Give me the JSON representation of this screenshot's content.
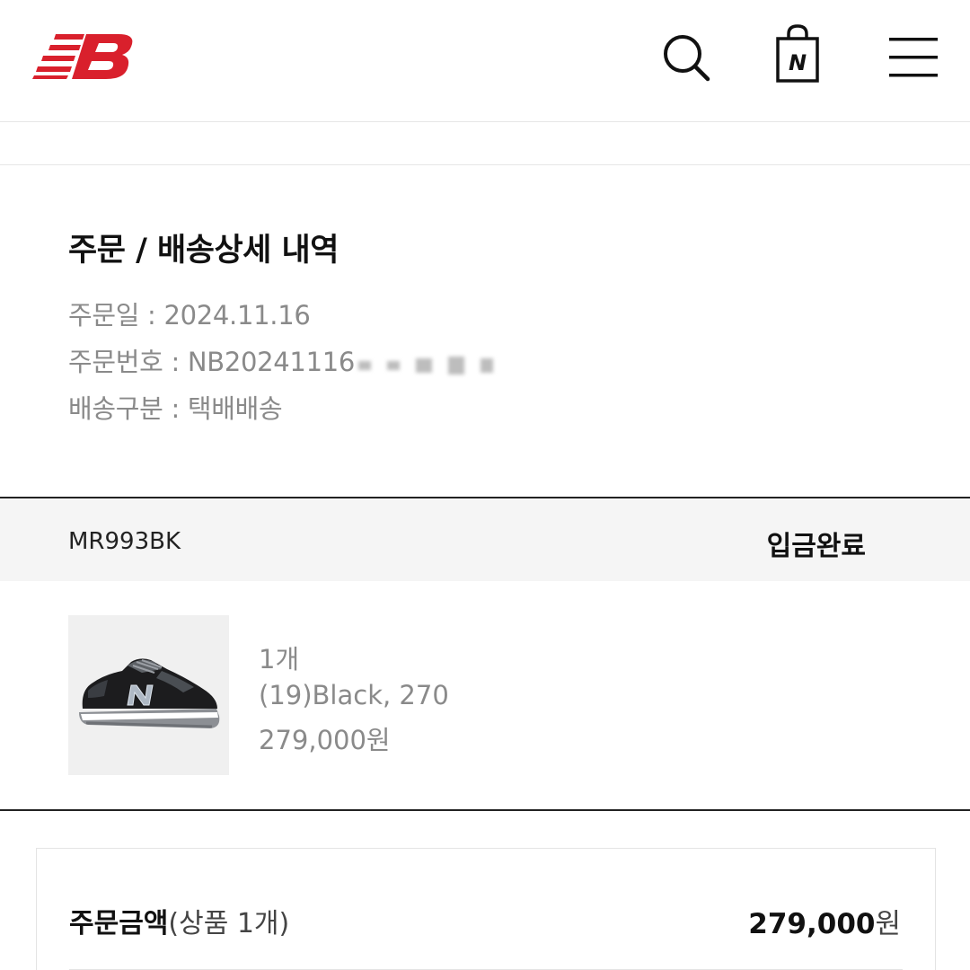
{
  "header": {
    "logo_alt": "New Balance",
    "icons": [
      "search-icon",
      "shopping-bag-icon",
      "hamburger-menu-icon"
    ],
    "bag_letter": "N",
    "brand_color": "#d9202c"
  },
  "order": {
    "title": "주문 / 배송상세 내역",
    "date_label": "주문일 : 2024.11.16",
    "number_label": "주문번호 : NB20241116",
    "delivery_label": "배송구분 : 택배배송"
  },
  "product": {
    "code": "MR993BK",
    "status": "입금완료",
    "quantity": "1개",
    "option": "(19)Black, 270",
    "price": "279,000원",
    "image": "black-grey-sneaker"
  },
  "summary": {
    "label": "주문금액",
    "count_note": "(상품 1개)",
    "amount": "279,000",
    "currency": "원"
  }
}
